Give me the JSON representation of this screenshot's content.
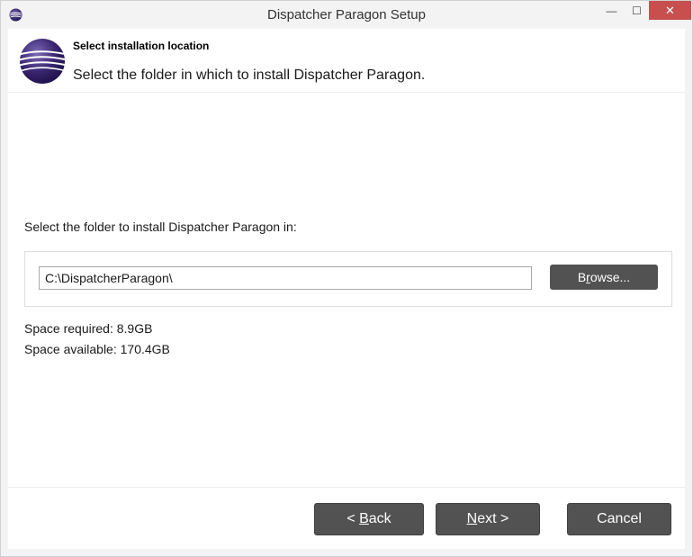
{
  "window": {
    "title": "Dispatcher Paragon Setup",
    "minimize_glyph": "—",
    "maximize_glyph": "☐",
    "close_glyph": "✕"
  },
  "header": {
    "title": "Select installation location",
    "subtitle": "Select the folder in which to install Dispatcher Paragon."
  },
  "content": {
    "folder_label": "Select the folder to install Dispatcher Paragon in:",
    "path_value": "C:\\DispatcherParagon\\",
    "browse_pre": "B",
    "browse_mnemonic": "r",
    "browse_post": "owse...",
    "space_required": "Space required: 8.9GB",
    "space_available": "Space available: 170.4GB"
  },
  "footer": {
    "back_pre": "< ",
    "back_mnemonic": "B",
    "back_post": "ack",
    "next_mnemonic": "N",
    "next_post": "ext >",
    "cancel_label": "Cancel"
  },
  "colors": {
    "button_bg": "#525252",
    "close_bg": "#c7504e",
    "logo_dark": "#2e1a5c",
    "logo_light": "#7b6bb5"
  },
  "icons": {
    "title_icon": "app-logo-icon",
    "header_logo": "paragon-logo-icon"
  }
}
